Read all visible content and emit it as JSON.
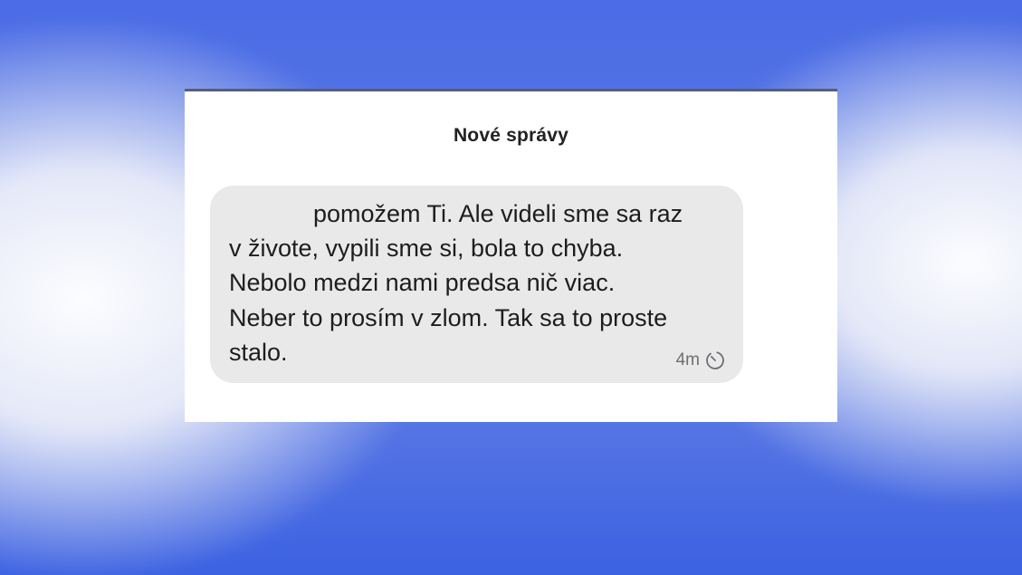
{
  "dialog": {
    "title": "Nové správy"
  },
  "message": {
    "lines": [
      "pomožem Ti. Ale videli sme sa raz",
      "v živote, vypili sme si, bola to chyba.",
      "Nebolo medzi nami predsa nič viac.",
      "Neber to prosím v zlom. Tak sa to proste",
      "stalo."
    ],
    "time": "4m",
    "time_icon": "timer-icon"
  },
  "colors": {
    "background_blue": "#4f6fe3",
    "bubble": "#e9e9ea",
    "text": "#1d1d1f",
    "meta": "#6e6e73"
  }
}
